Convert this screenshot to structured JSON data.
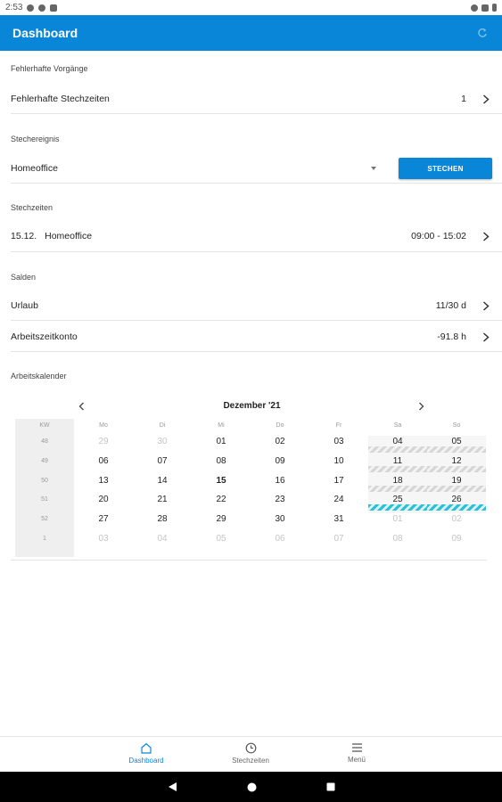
{
  "status_bar": {
    "time": "2:53"
  },
  "app_bar": {
    "title": "Dashboard",
    "refresh_icon": "refresh-icon"
  },
  "sections": {
    "errors": {
      "label": "Fehlerhafte Vorgänge",
      "row_label": "Fehlerhafte Stechzeiten",
      "row_value": "1"
    },
    "event": {
      "label": "Stechereignis",
      "selected": "Homeoffice",
      "button": "STECHEN"
    },
    "times": {
      "label": "Stechzeiten",
      "date": "15.12.",
      "type": "Homeoffice",
      "range": "09:00 - 15:02"
    },
    "balances": {
      "label": "Salden",
      "items": [
        {
          "label": "Urlaub",
          "value": "11/30 d"
        },
        {
          "label": "Arbeitszeitkonto",
          "value": "-91.8 h"
        }
      ]
    },
    "calendar": {
      "label": "Arbeitskalender",
      "month": "Dezember '21",
      "headers": [
        "KW",
        "Mo",
        "Di",
        "Mi",
        "Do",
        "Fr",
        "Sa",
        "So"
      ],
      "weeks": [
        {
          "kw": "48",
          "days": [
            "29",
            "30",
            "01",
            "02",
            "03",
            "04",
            "05"
          ]
        },
        {
          "kw": "49",
          "days": [
            "06",
            "07",
            "08",
            "09",
            "10",
            "11",
            "12"
          ]
        },
        {
          "kw": "50",
          "days": [
            "13",
            "14",
            "15",
            "16",
            "17",
            "18",
            "19"
          ]
        },
        {
          "kw": "51",
          "days": [
            "20",
            "21",
            "22",
            "23",
            "24",
            "25",
            "26"
          ]
        },
        {
          "kw": "52",
          "days": [
            "27",
            "28",
            "29",
            "30",
            "31",
            "01",
            "02"
          ]
        },
        {
          "kw": "1",
          "days": [
            "03",
            "04",
            "05",
            "06",
            "07",
            "08",
            "09"
          ]
        }
      ],
      "today": "15",
      "colors": {
        "weekend_stripe": "#d6d6d6",
        "holiday_stripe": "#2dbfd4"
      }
    }
  },
  "bottom_nav": [
    {
      "label": "Dashboard",
      "icon": "home-icon",
      "active": true
    },
    {
      "label": "Stechzeiten",
      "icon": "clock-icon",
      "active": false
    },
    {
      "label": "Menü",
      "icon": "menu-icon",
      "active": false
    }
  ],
  "colors": {
    "primary": "#0a86d8"
  }
}
